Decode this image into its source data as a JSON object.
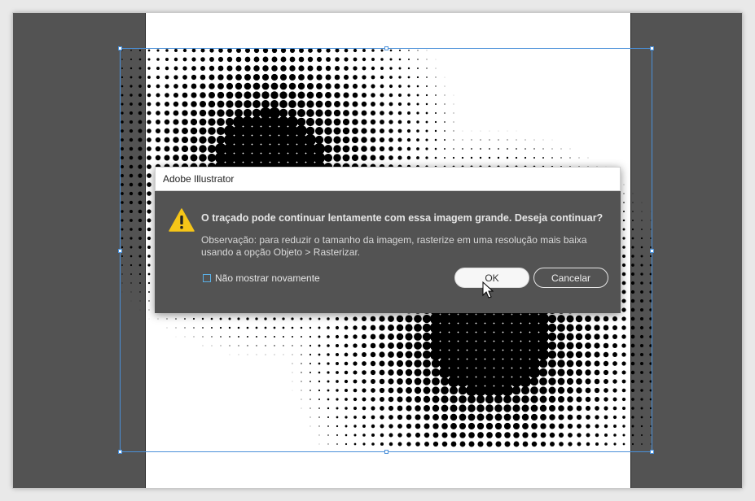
{
  "dialog": {
    "title": "Adobe Illustrator",
    "message": "O traçado pode continuar lentamente com essa imagem grande. Deseja continuar?",
    "note": "Observação: para reduzir o tamanho da imagem, rasterize em uma resolução mais baixa usando a opção Objeto > Rasterizar.",
    "checkbox_label": "Não mostrar novamente",
    "checkbox_checked": false,
    "ok_label": "OK",
    "cancel_label": "Cancelar",
    "icon": "warning-icon"
  },
  "colors": {
    "workspace": "#535353",
    "artboard": "#ffffff",
    "selection": "#4a90d9",
    "dialog_bg": "#535353",
    "warning": "#f5c518",
    "checkbox_border": "#5ab0e6"
  }
}
